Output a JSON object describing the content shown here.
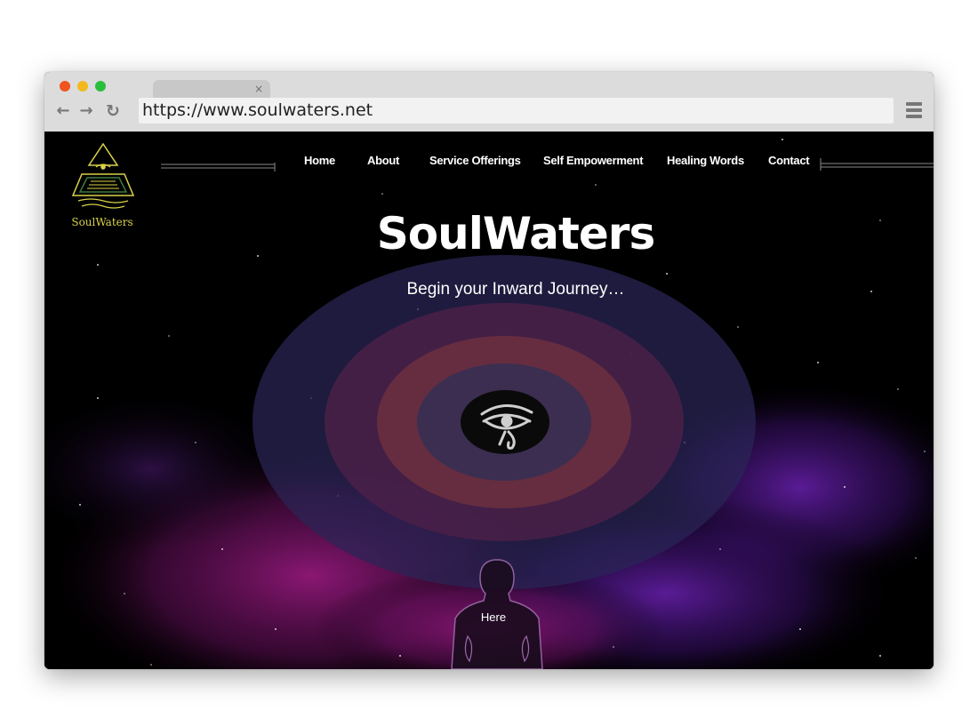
{
  "browser": {
    "url": "https://www.soulwaters.net",
    "tab_close": "×",
    "back": "←",
    "forward": "→",
    "reload": "↻"
  },
  "site": {
    "logo_text": "SoulWaters",
    "nav": [
      {
        "label": "Home"
      },
      {
        "label": "About"
      },
      {
        "label": "Service Offerings"
      },
      {
        "label": "Self Empowerment"
      },
      {
        "label": "Healing Words"
      },
      {
        "label": "Contact"
      }
    ],
    "hero_title": "SoulWaters",
    "hero_subtitle": "Begin your Inward Journey…",
    "center_icon": "eye-of-horus-icon",
    "figure_label": "Here"
  },
  "colors": {
    "logo_gold": "#d8d24a",
    "ring_outer": "#2e2a58",
    "ring_mid": "#5a2450",
    "ring_inner": "#7a3540",
    "nebula_magenta": "#8a1870",
    "nebula_purple": "#5a1a9a"
  }
}
